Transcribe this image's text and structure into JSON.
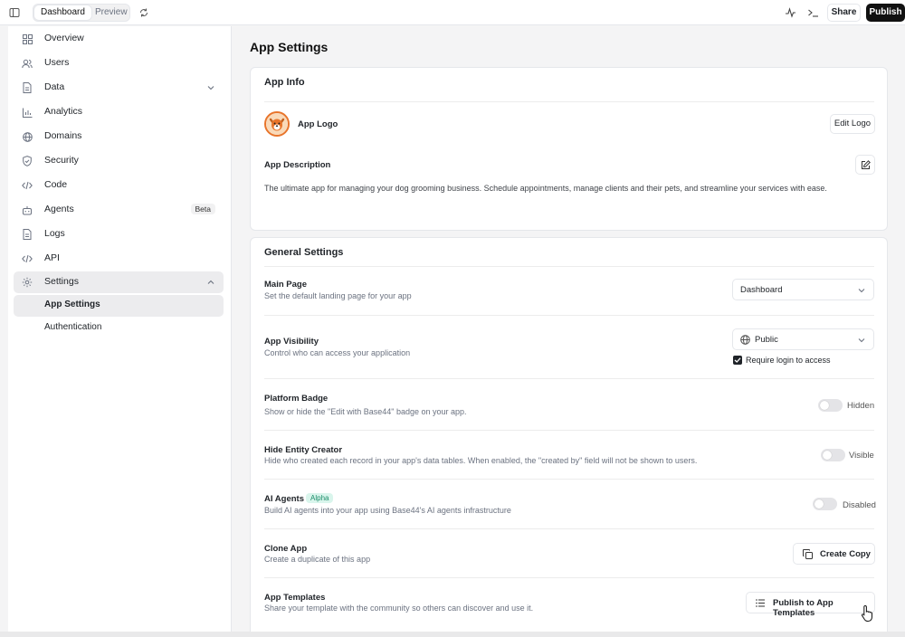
{
  "topbar": {
    "tab_dashboard": "Dashboard",
    "tab_preview": "Preview",
    "share_label": "Share",
    "publish_label": "Publish"
  },
  "sidebar": {
    "items": [
      {
        "label": "Overview",
        "icon": "grid-icon"
      },
      {
        "label": "Users",
        "icon": "users-icon"
      },
      {
        "label": "Data",
        "icon": "file-icon"
      },
      {
        "label": "Analytics",
        "icon": "bar-chart-icon"
      },
      {
        "label": "Domains",
        "icon": "globe-icon"
      },
      {
        "label": "Security",
        "icon": "shield-icon"
      },
      {
        "label": "Code",
        "icon": "code-icon"
      },
      {
        "label": "Agents",
        "icon": "bot-icon",
        "badge": "Beta"
      },
      {
        "label": "Logs",
        "icon": "file-icon"
      },
      {
        "label": "API",
        "icon": "code-icon"
      },
      {
        "label": "Settings",
        "icon": "gear-icon"
      }
    ],
    "settings_sub": [
      "App Settings",
      "Authentication"
    ]
  },
  "main": {
    "title": "App Settings",
    "app_info": {
      "heading": "App Info",
      "logo_label": "App Logo",
      "edit_logo": "Edit Logo",
      "description_label": "App Description",
      "description": "The ultimate app for managing your dog grooming business. Schedule appointments, manage clients and their pets, and streamline your services with ease."
    },
    "general": {
      "heading": "General Settings",
      "main_page": {
        "label": "Main Page",
        "desc": "Set the default landing page for your app",
        "value": "Dashboard"
      },
      "visibility": {
        "label": "App Visibility",
        "desc": "Control who can access your application",
        "value": "Public",
        "require_login": "Require login to access"
      },
      "platform_badge": {
        "label": "Platform Badge",
        "desc": "Show or hide the \"Edit with Base44\" badge on your app.",
        "state": "Hidden"
      },
      "hide_entity": {
        "label": "Hide Entity Creator",
        "desc": "Hide who created each record in your app's data tables. When enabled, the \"created by\" field will not be shown to users.",
        "state": "Visible"
      },
      "ai_agents": {
        "label": "AI Agents",
        "badge": "Alpha",
        "desc": "Build AI agents into your app using Base44's AI agents infrastructure",
        "state": "Disabled"
      },
      "clone": {
        "label": "Clone App",
        "desc": "Create a duplicate of this app",
        "button": "Create Copy"
      },
      "templates": {
        "label": "App Templates",
        "desc": "Share your template with the community so others can discover and use it.",
        "button": "Publish to App Templates"
      }
    }
  },
  "colors": {
    "accent_dark": "#111111",
    "alpha_badge_bg": "#d9f5ec",
    "alpha_badge_text": "#1c8c69"
  }
}
